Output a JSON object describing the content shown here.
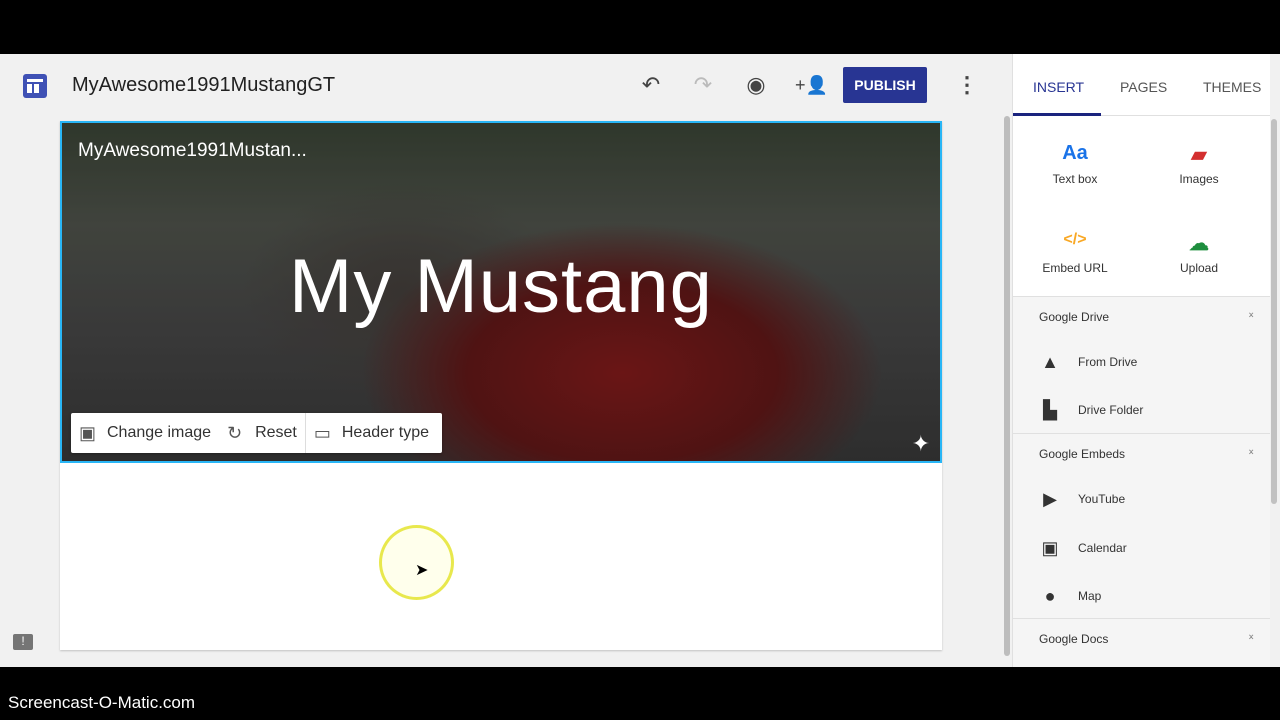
{
  "app": {
    "title": "MyAwesome1991MustangGT",
    "publish_label": "PUBLISH"
  },
  "toolbar": {
    "icons": [
      "undo-icon",
      "redo-icon",
      "preview-eye-icon",
      "share-person-add-icon",
      "more-vert-icon"
    ]
  },
  "header": {
    "site_name": "MyAwesome1991Mustan...",
    "title": "My Mustang",
    "buttons": {
      "change_image": "Change image",
      "reset": "Reset",
      "header_type": "Header type"
    }
  },
  "panel": {
    "tabs": [
      "INSERT",
      "PAGES",
      "THEMES"
    ],
    "insert": {
      "text_box": "Text box",
      "images": "Images",
      "embed_url": "Embed URL",
      "upload": "Upload"
    },
    "sections": {
      "drive": {
        "title": "Google Drive",
        "items": [
          "From Drive",
          "Drive Folder"
        ]
      },
      "embeds": {
        "title": "Google Embeds",
        "items": [
          "YouTube",
          "Calendar",
          "Map"
        ]
      },
      "docs": {
        "title": "Google Docs"
      }
    },
    "colors": {
      "text_box": "#1a73e8",
      "images": "#d32f2f",
      "embed": "#f9a825",
      "upload": "#1e8e3e",
      "accent": "#283593"
    }
  },
  "watermark": "Screencast-O-Matic.com"
}
